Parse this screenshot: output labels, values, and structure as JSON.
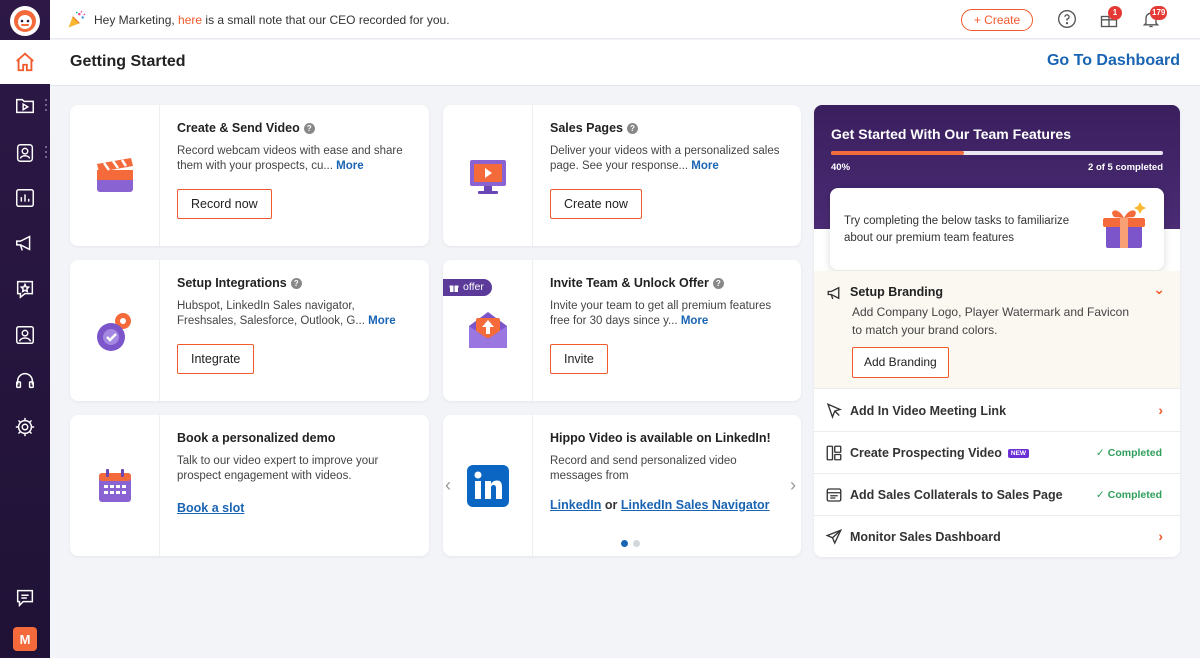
{
  "topbar": {
    "note_prefix": "Hey Marketing,",
    "note_link": "here",
    "note_suffix": "is a small note that our CEO recorded for you.",
    "create_label": "+ Create",
    "gift_badge": "1",
    "bell_badge": "179"
  },
  "sidebar": {
    "avatar_letter": "M",
    "items": [
      "home-icon",
      "video-library-icon",
      "contacts-icon",
      "analytics-icon",
      "megaphone-icon",
      "star-icon",
      "presentation-icon",
      "headset-icon",
      "gear-icon",
      "feedback-icon"
    ]
  },
  "header": {
    "title": "Getting Started",
    "dashboard_link": "Go To Dashboard"
  },
  "cards": {
    "create_video": {
      "title": "Create & Send Video",
      "desc": "Record webcam videos with ease and share them with your prospects, cu...",
      "more": "More",
      "button": "Record now"
    },
    "sales_pages": {
      "title": "Sales Pages",
      "desc": "Deliver your videos with a personalized sales page. See your response...",
      "more": "More",
      "button": "Create now"
    },
    "integrations": {
      "title": "Setup Integrations",
      "desc": "Hubspot, LinkedIn Sales navigator, Freshsales, Salesforce, Outlook, G...",
      "more": "More",
      "button": "Integrate"
    },
    "invite_team": {
      "tag": "offer",
      "title": "Invite Team & Unlock Offer",
      "desc": "Invite your team to get all premium features free for 30 days since y...",
      "more": "More",
      "button": "Invite"
    },
    "demo": {
      "title": "Book a personalized demo",
      "desc": "Talk to our video expert to improve your prospect engagement with videos.",
      "link": "Book a slot"
    },
    "linkedin": {
      "title": "Hippo Video is available on LinkedIn!",
      "desc": "Record and send personalized video messages from",
      "link1": "LinkedIn",
      "or": "or",
      "link2": "LinkedIn Sales Navigator"
    }
  },
  "panel": {
    "title": "Get Started With Our Team Features",
    "progress_pct": 40,
    "progress_label": "40%",
    "progress_count": "2 of 5 completed",
    "tip": "Try completing the below tasks to familiarize about our premium team features",
    "branding": {
      "title": "Setup Branding",
      "desc": "Add Company Logo, Player Watermark and Favicon to match your brand colors.",
      "button": "Add Branding"
    },
    "tasks": [
      {
        "label": "Add In Video Meeting Link",
        "status": ""
      },
      {
        "label": "Create Prospecting Video",
        "badge": "NEW",
        "status": "Completed"
      },
      {
        "label": "Add Sales Collaterals to Sales Page",
        "status": "Completed"
      },
      {
        "label": "Monitor Sales Dashboard",
        "status": ""
      }
    ]
  },
  "colors": {
    "accent": "#f15a2b",
    "link": "#1a64b4",
    "sidebar": "#2d1846",
    "success": "#2e9e5b"
  }
}
